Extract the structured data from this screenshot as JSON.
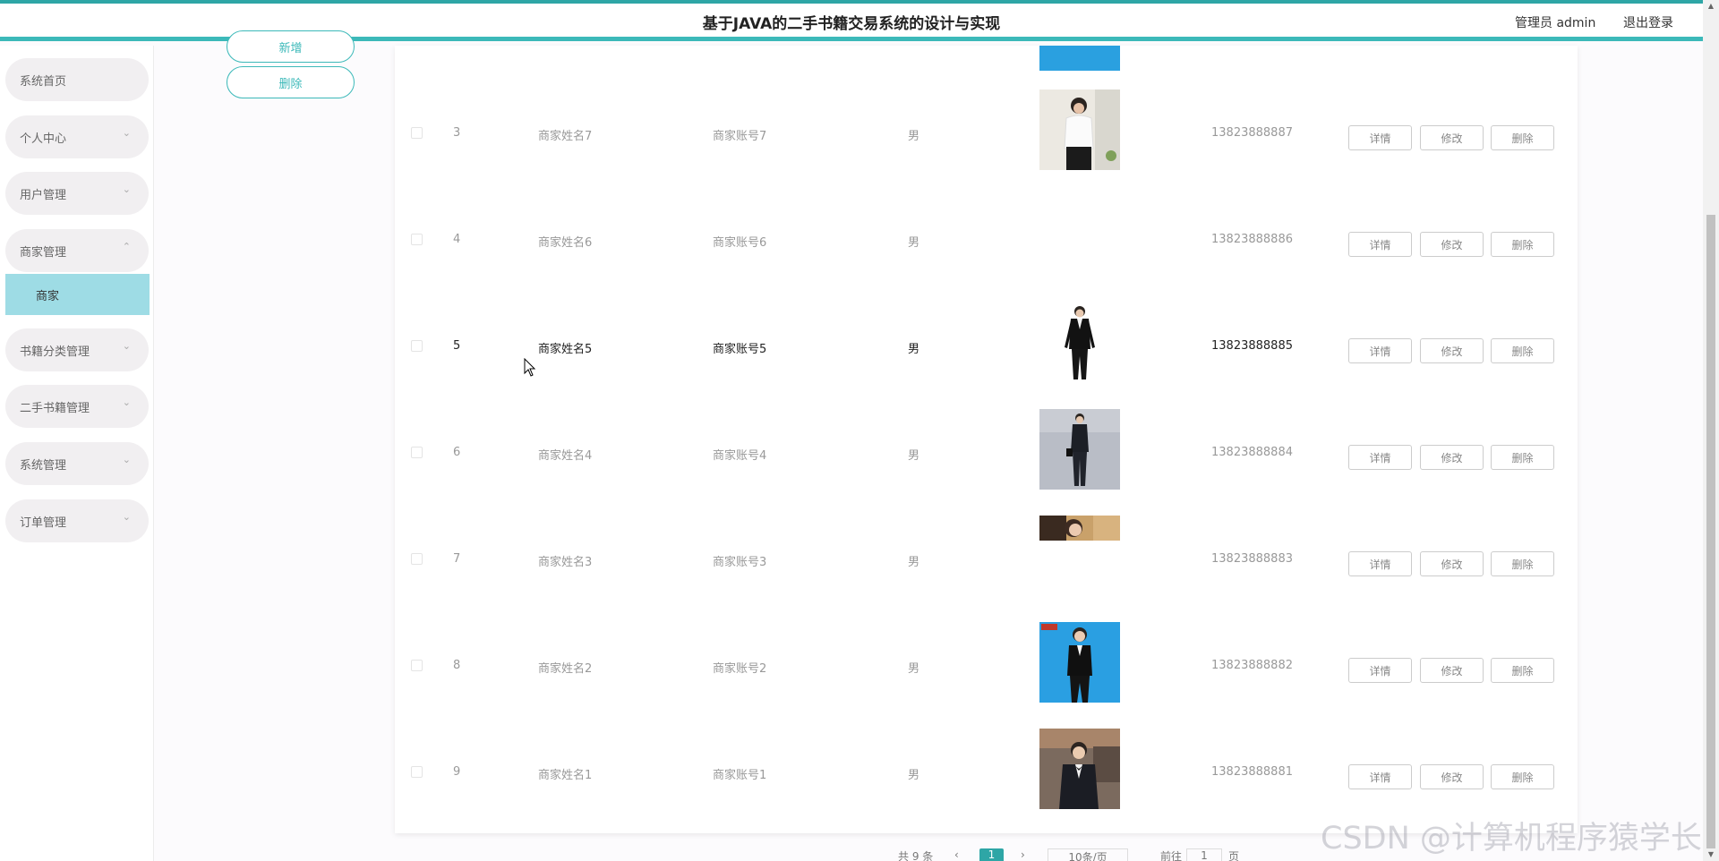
{
  "header": {
    "title": "基于JAVA的二手书籍交易系统的设计与实现",
    "admin_label": "管理员 admin",
    "logout_label": "退出登录"
  },
  "sidebar": {
    "items": [
      {
        "label": "系统首页",
        "chevron": ""
      },
      {
        "label": "个人中心",
        "chevron": "⌄"
      },
      {
        "label": "用户管理",
        "chevron": "⌄"
      },
      {
        "label": "商家管理",
        "chevron": "⌃"
      },
      {
        "label": "书籍分类管理",
        "chevron": "⌄"
      },
      {
        "label": "二手书籍管理",
        "chevron": "⌄"
      },
      {
        "label": "系统管理",
        "chevron": "⌄"
      },
      {
        "label": "订单管理",
        "chevron": "⌄"
      }
    ],
    "sub_item": {
      "label": "商家"
    }
  },
  "actions": {
    "add_label": "新增",
    "delete_label": "删除"
  },
  "table": {
    "buttons": {
      "detail": "详情",
      "edit": "修改",
      "delete": "删除"
    },
    "rows": [
      {
        "index": "3",
        "name": "商家姓名7",
        "account": "商家账号7",
        "gender": "男",
        "phone": "13823888887",
        "photo": "woman-white-shirt"
      },
      {
        "index": "4",
        "name": "商家姓名6",
        "account": "商家账号6",
        "gender": "男",
        "phone": "13823888886",
        "photo": "none"
      },
      {
        "index": "5",
        "name": "商家姓名5",
        "account": "商家账号5",
        "gender": "男",
        "phone": "13823888885",
        "photo": "woman-black-suit"
      },
      {
        "index": "6",
        "name": "商家姓名4",
        "account": "商家账号4",
        "gender": "男",
        "phone": "13823888884",
        "photo": "woman-suit-grey"
      },
      {
        "index": "7",
        "name": "商家姓名3",
        "account": "商家账号3",
        "gender": "男",
        "phone": "13823888883",
        "photo": "woman-partial"
      },
      {
        "index": "8",
        "name": "商家姓名2",
        "account": "商家账号2",
        "gender": "男",
        "phone": "13823888882",
        "photo": "woman-suit-blue"
      },
      {
        "index": "9",
        "name": "商家姓名1",
        "account": "商家账号1",
        "gender": "男",
        "phone": "13823888881",
        "photo": "man-suit"
      }
    ]
  },
  "pagination": {
    "total": "共 9 条",
    "current_page": "1",
    "page_size": "10条/页",
    "goto_label": "前往",
    "goto_value": "1",
    "page_unit": "页"
  },
  "watermark": "CSDN @计算机程序猿学长"
}
